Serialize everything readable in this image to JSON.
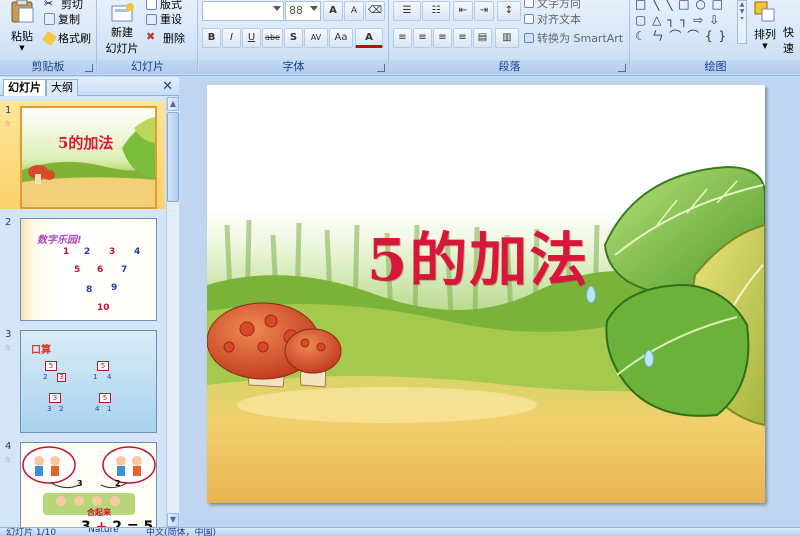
{
  "ribbon": {
    "clipboard": {
      "paste_label": "粘贴",
      "cut_label": "剪切",
      "copy_label": "复制",
      "format_painter_label": "格式刷",
      "group_label": "剪贴板"
    },
    "slides": {
      "new_slide_label_1": "新建",
      "new_slide_label_2": "幻灯片",
      "layout_label": "版式",
      "reset_label": "重设",
      "delete_label": "删除",
      "group_label": "幻灯片"
    },
    "font": {
      "size_value": "88",
      "grow_label": "A",
      "shrink_label": "A",
      "bold_label": "B",
      "italic_label": "I",
      "underline_label": "U",
      "strike_label": "abe",
      "shadow_label": "S",
      "spacing_label": "AV",
      "case_label": "Aa",
      "color_label": "A",
      "group_label": "字体"
    },
    "paragraph": {
      "text_direction_label": "文字方向",
      "align_text_label": "对齐文本",
      "smartart_label": "转换为 SmartArt",
      "group_label": "段落"
    },
    "drawing": {
      "arrange_label": "排列",
      "quick_styles_label": "快速",
      "group_label": "绘图"
    }
  },
  "left_pane": {
    "tab_slides": "幻灯片",
    "tab_outline": "大纲",
    "close_glyph": "✕",
    "thumbnails": [
      {
        "number": "1",
        "title": "5的加法"
      },
      {
        "number": "2",
        "title": "数字乐园!",
        "numbers": [
          "1",
          "2",
          "3",
          "4",
          "5",
          "6",
          "7",
          "8",
          "9",
          "10"
        ]
      },
      {
        "number": "3",
        "title": "口算",
        "numbers": [
          "5",
          "2",
          "3",
          "1",
          "4",
          "5",
          "3",
          "2",
          "4",
          "1"
        ]
      },
      {
        "number": "4",
        "caption": "合起来",
        "equation_left": "3",
        "equation_op": "+",
        "equation_right": "2",
        "equation_result": "= 5",
        "circle_labels": [
          "3",
          "2"
        ]
      }
    ]
  },
  "slide": {
    "title": "5的加法"
  },
  "status_bar": {
    "slide_counter": "幻灯片 1/10",
    "theme": "\"Nature\"",
    "language": "中文(简体，中国)"
  },
  "colors": {
    "title_red": "#d8163a",
    "ribbon_text": "#15428b",
    "selected_thumb": "#fbd26d"
  }
}
